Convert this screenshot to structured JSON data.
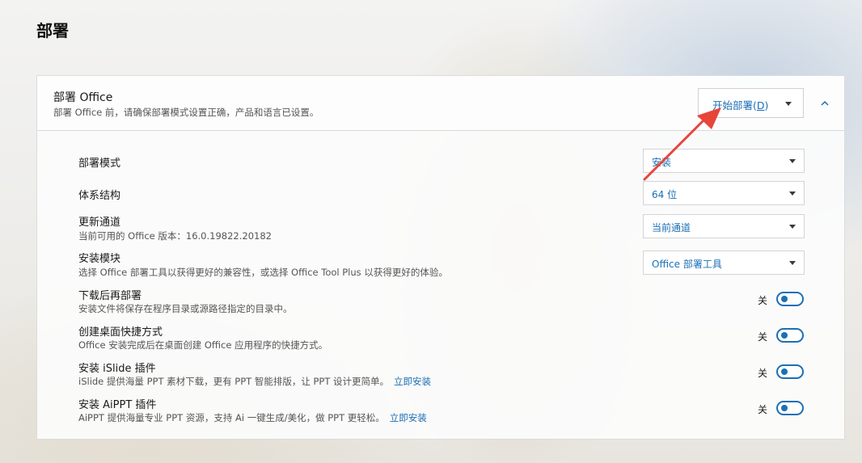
{
  "page": {
    "title": "部署"
  },
  "panel": {
    "title": "部署 Office",
    "description": "部署 Office 前，请确保部署模式设置正确，产品和语言已设置。",
    "deploy_button": {
      "label_prefix": "开始部署(",
      "shortcut": "D",
      "label_suffix": ")"
    },
    "collapse_icon": "chevron-up-icon"
  },
  "settings": [
    {
      "label": "部署模式",
      "description": "",
      "value": "安装"
    },
    {
      "label": "体系结构",
      "description": "",
      "value": "64 位"
    },
    {
      "label": "更新通道",
      "description": "当前可用的 Office 版本：16.0.19822.20182",
      "value": "当前通道"
    },
    {
      "label": "安装模块",
      "description": "选择 Office 部署工具以获得更好的兼容性，或选择 Office Tool Plus 以获得更好的体验。",
      "value": "Office 部署工具"
    }
  ],
  "toggles": [
    {
      "label": "下载后再部署",
      "description": "安装文件将保存在程序目录或源路径指定的目录中。",
      "link": "",
      "state": "关"
    },
    {
      "label": "创建桌面快捷方式",
      "description": "Office 安装完成后在桌面创建 Office 应用程序的快捷方式。",
      "link": "",
      "state": "关"
    },
    {
      "label": "安装 iSlide 插件",
      "description": "iSlide 提供海量 PPT 素材下载，更有 PPT 智能排版，让 PPT 设计更简单。",
      "link": "立即安装",
      "state": "关"
    },
    {
      "label": "安装 AiPPT 插件",
      "description": "AiPPT 提供海量专业 PPT 资源，支持 Ai 一键生成/美化，做 PPT 更轻松。",
      "link": "立即安装",
      "state": "关"
    }
  ],
  "colors": {
    "accent": "#1b6fb5",
    "annotation_arrow": "#e8443a"
  }
}
